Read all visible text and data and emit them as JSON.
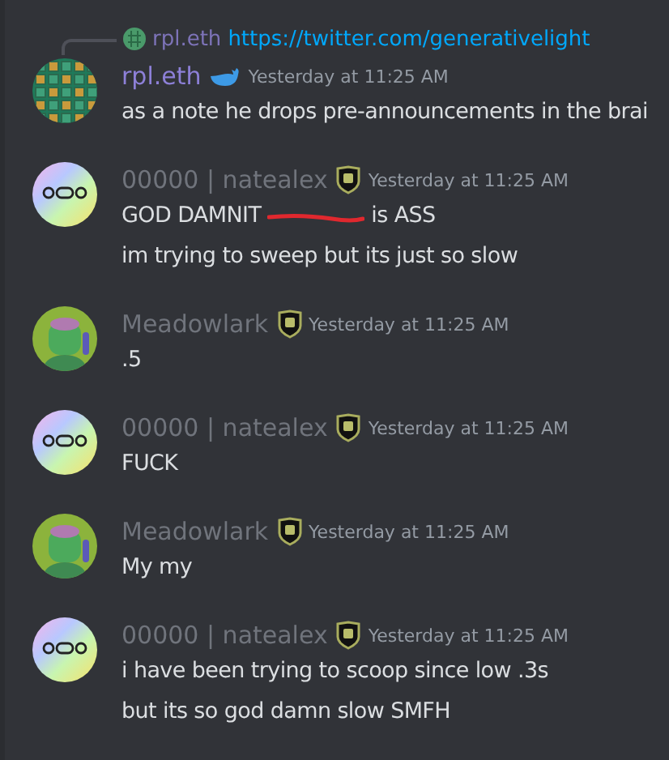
{
  "messages": [
    {
      "author": {
        "name": "rpl.eth",
        "color": "#8d80d8"
      },
      "badge": {
        "kind": "whale"
      },
      "time": "Yesterday at 11:25 AM",
      "avatar": {
        "kind": "pattern"
      },
      "reply": {
        "author": "rpl.eth",
        "link": "https://twitter.com/generativelight"
      },
      "lines": [
        [
          {
            "kind": "text",
            "text": "as a note he drops pre-announcements in the brai"
          }
        ]
      ]
    },
    {
      "author": {
        "name": "00000 | natealex",
        "color": "#70747c"
      },
      "badge": {
        "kind": "shield"
      },
      "time": "Yesterday at 11:25 AM",
      "avatar": {
        "kind": "rainbow"
      },
      "lines": [
        [
          {
            "kind": "text",
            "text": "GOD DAMNIT"
          },
          {
            "kind": "scribble"
          },
          {
            "kind": "text",
            "text": "is ASS"
          }
        ],
        [
          {
            "kind": "text",
            "text": "im trying to sweep but its just so slow"
          }
        ]
      ]
    },
    {
      "author": {
        "name": "Meadowlark",
        "color": "#70747c"
      },
      "badge": {
        "kind": "shield"
      },
      "time": "Yesterday at 11:25 AM",
      "avatar": {
        "kind": "figure"
      },
      "lines": [
        [
          {
            "kind": "text",
            "text": ".5"
          }
        ]
      ]
    },
    {
      "author": {
        "name": "00000 | natealex",
        "color": "#70747c"
      },
      "badge": {
        "kind": "shield"
      },
      "time": "Yesterday at 11:25 AM",
      "avatar": {
        "kind": "rainbow"
      },
      "lines": [
        [
          {
            "kind": "text",
            "text": "FUCK"
          }
        ]
      ]
    },
    {
      "author": {
        "name": "Meadowlark",
        "color": "#70747c"
      },
      "badge": {
        "kind": "shield"
      },
      "time": "Yesterday at 11:25 AM",
      "avatar": {
        "kind": "figure"
      },
      "lines": [
        [
          {
            "kind": "text",
            "text": "My my"
          }
        ]
      ]
    },
    {
      "author": {
        "name": "00000 | natealex",
        "color": "#70747c"
      },
      "badge": {
        "kind": "shield"
      },
      "time": "Yesterday at 11:25 AM",
      "avatar": {
        "kind": "rainbow"
      },
      "lines": [
        [
          {
            "kind": "text",
            "text": "i have been trying to scoop since low .3s"
          }
        ],
        [
          {
            "kind": "text",
            "text": "but its so god damn slow SMFH"
          }
        ]
      ]
    }
  ]
}
